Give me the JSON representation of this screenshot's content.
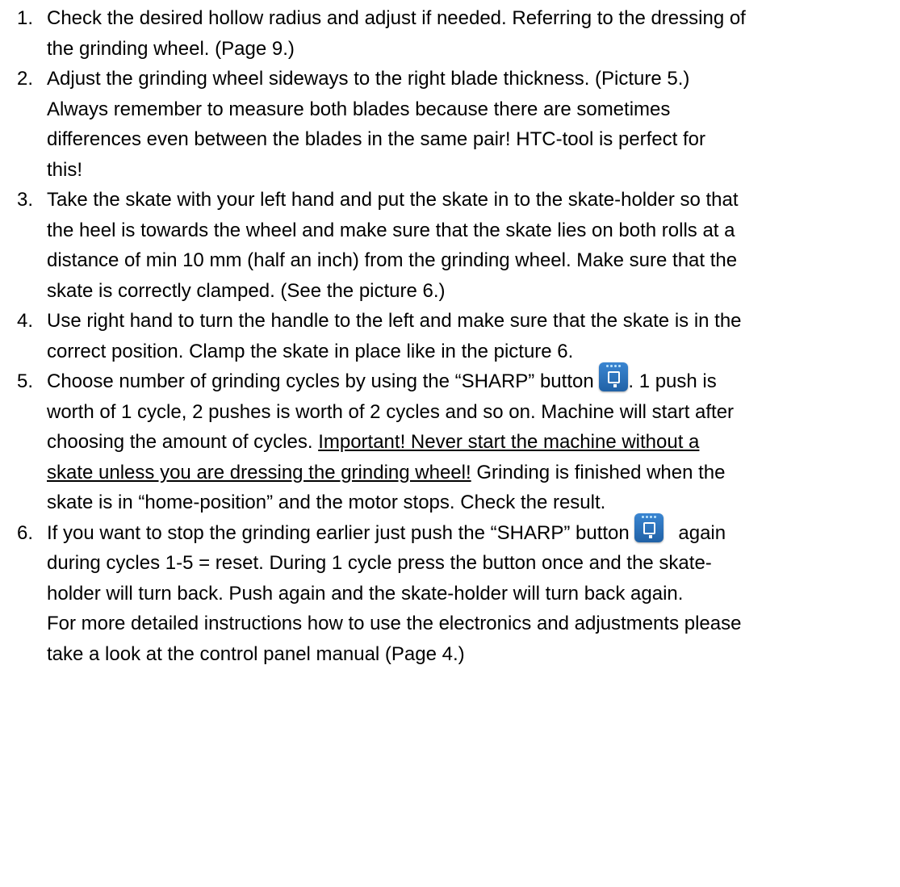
{
  "items": [
    {
      "number": "1.",
      "lines": [
        "Check the desired hollow radius and adjust if needed. Referring to the dressing of",
        "the grinding wheel. (Page 9.)"
      ]
    },
    {
      "number": "2.",
      "lines": [
        "Adjust the grinding wheel sideways to the right blade thickness. (Picture 5.)",
        "Always remember to measure both blades because there are sometimes",
        "differences even between the blades in the same pair! HTC-tool is perfect for",
        "this!"
      ]
    },
    {
      "number": "3.",
      "lines": [
        "Take the skate with your left hand and put the skate in to the skate-holder so that",
        "the heel is towards the wheel and make sure that the skate lies on both rolls at a",
        "distance of min 10 mm (half an inch) from the grinding wheel. Make sure that the",
        "skate is correctly clamped. (See the picture 6.)"
      ]
    },
    {
      "number": "4.",
      "lines": [
        "Use right hand to turn the handle to the left and make sure that the skate is in the",
        "correct position. Clamp the skate in place like in the picture 6."
      ]
    },
    {
      "number": "5.",
      "line1_before": "Choose number of grinding cycles by using the “SHARP” button ",
      "line1_after": ". 1 push is",
      "line2": "worth of 1 cycle, 2 pushes is worth of 2 cycles and so on. Machine will start after",
      "line3_before": "choosing the amount of cycles. ",
      "line3_underlined": "Important! Never start the machine without a",
      "line4_underlined": "skate unless you are dressing the grinding wheel!",
      "line4_after": " Grinding is finished when the",
      "line5": "skate is in “home-position” and the motor stops. Check the result."
    },
    {
      "number": "6.",
      "line1_before": "If you want to stop the grinding earlier just push the “SHARP” button ",
      "line1_after": "again",
      "lines_rest": [
        "during cycles 1-5 = reset. During 1 cycle press the button once and the skate-",
        "holder will turn back. Push again and the skate-holder will turn back again.",
        "For more detailed instructions how to use the electronics and adjustments please",
        "take a look at the control panel manual (Page 4.)"
      ]
    }
  ],
  "icons": {
    "sharp_button": "sharp-button-icon",
    "accent_color": "#2a6fb8"
  }
}
